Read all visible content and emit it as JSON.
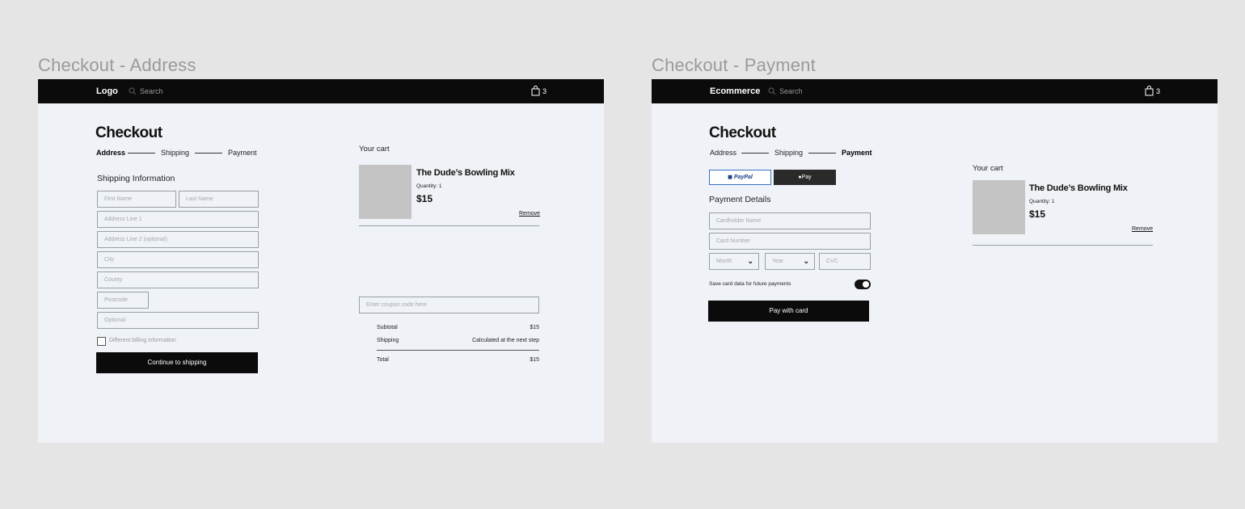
{
  "frames": {
    "address": {
      "frame_title": "Checkout - Address",
      "logo": "Logo",
      "search": "Search",
      "cart_count": "3",
      "page_title": "Checkout",
      "steps": [
        "Address",
        "Shipping",
        "Payment"
      ],
      "active_step": "Address",
      "section_title": "Shipping Information",
      "placeholders": {
        "first_name": "First Name",
        "last_name": "Last Name",
        "address1": "Address Line 1",
        "address2": "Address Line 2 (optional)",
        "city": "City",
        "county": "County",
        "postcode": "Postcode",
        "optional": "Optional"
      },
      "billing_checkbox": "Different billing information",
      "continue_button": "Continue to shipping",
      "cart": {
        "title": "Your cart",
        "product": "The Dude’s Bowling Mix",
        "quantity": "Quantity: 1",
        "price": "$15",
        "remove": "Remove"
      },
      "coupon_placeholder": "Enter coupon code here",
      "summary": {
        "subtotal_label": "Subtotal",
        "subtotal_value": "$15",
        "shipping_label": "Shipping",
        "shipping_value": "Calculated at the next step",
        "total_label": "Total",
        "total_value": "$15"
      }
    },
    "payment": {
      "frame_title": "Checkout - Payment",
      "logo": "Ecommerce",
      "search": "Search",
      "cart_count": "3",
      "page_title": "Checkout",
      "steps": [
        "Address",
        "Shipping",
        "Payment"
      ],
      "active_step": "Payment",
      "paypal_label": "PayPal",
      "applepay_label": "Pay",
      "section_title": "Payment Details",
      "placeholders": {
        "cardholder": "Cardholder Name",
        "card_number": "Card Number",
        "month": "Month",
        "year": "Year",
        "cvc": "CVC"
      },
      "save_card_label": "Save card data for future payments",
      "save_card_on": true,
      "pay_button": "Pay with card",
      "cart": {
        "title": "Your cart",
        "product": "The Dude’s Bowling Mix",
        "quantity": "Quantity: 1",
        "price": "$15",
        "remove": "Remove"
      }
    }
  }
}
